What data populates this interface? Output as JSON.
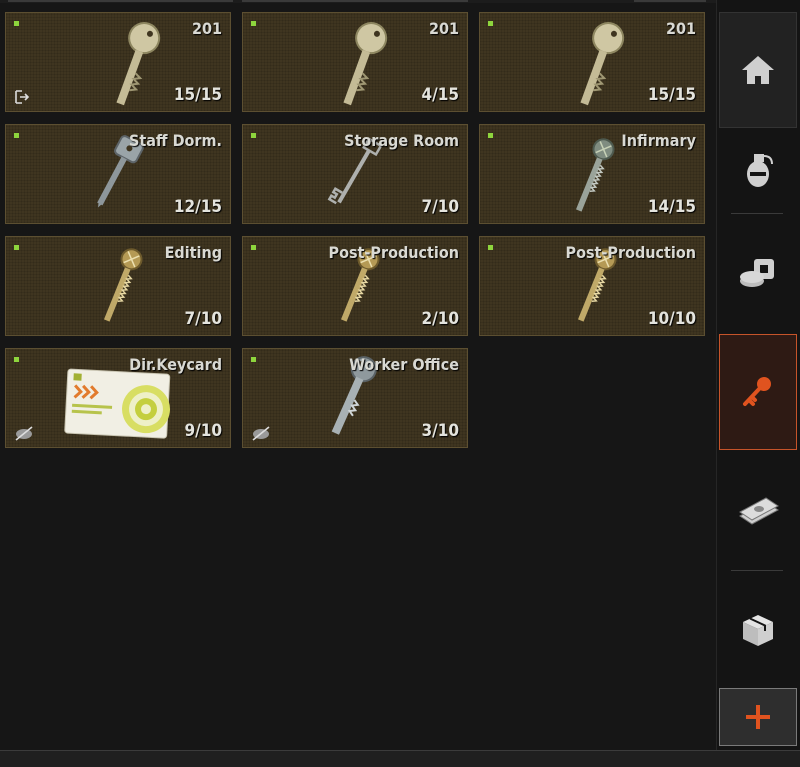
{
  "items": [
    {
      "name": "201",
      "uses": "15/15",
      "icon": "key-silver",
      "corner": "exit-icon"
    },
    {
      "name": "201",
      "uses": "4/15",
      "icon": "key-silver",
      "corner": ""
    },
    {
      "name": "201",
      "uses": "15/15",
      "icon": "key-silver",
      "corner": ""
    },
    {
      "name": "Staff Dorm.",
      "uses": "12/15",
      "icon": "key-steel",
      "corner": ""
    },
    {
      "name": "Storage Room",
      "uses": "7/10",
      "icon": "key-skeleton",
      "corner": ""
    },
    {
      "name": "Infirmary",
      "uses": "14/15",
      "icon": "key-serrated-grey",
      "corner": ""
    },
    {
      "name": "Editing",
      "uses": "7/10",
      "icon": "key-serrated-brass",
      "corner": ""
    },
    {
      "name": "Post-Production",
      "uses": "2/10",
      "icon": "key-serrated-brass",
      "corner": ""
    },
    {
      "name": "Post-Production",
      "uses": "10/10",
      "icon": "key-serrated-brass",
      "corner": ""
    },
    {
      "name": "Dir.Keycard",
      "uses": "9/10",
      "icon": "keycard",
      "corner": "not-insured-icon"
    },
    {
      "name": "Worker Office",
      "uses": "3/10",
      "icon": "key-steel-large",
      "corner": "not-insured-icon"
    }
  ],
  "sidebar": {
    "tabs": [
      {
        "id": "home",
        "icon": "home-icon"
      },
      {
        "id": "grenades",
        "icon": "grenade-icon"
      },
      {
        "id": "containers",
        "icon": "containers-icon"
      },
      {
        "id": "keys",
        "icon": "key-icon",
        "active": true
      },
      {
        "id": "money",
        "icon": "money-icon"
      },
      {
        "id": "boxes",
        "icon": "box-icon"
      }
    ],
    "add_icon": "plus-icon"
  },
  "colors": {
    "slot_bg": "#3f3520",
    "slot_border": "#5c4f31",
    "pip": "#8ed53d",
    "accent": "#e0531f"
  }
}
